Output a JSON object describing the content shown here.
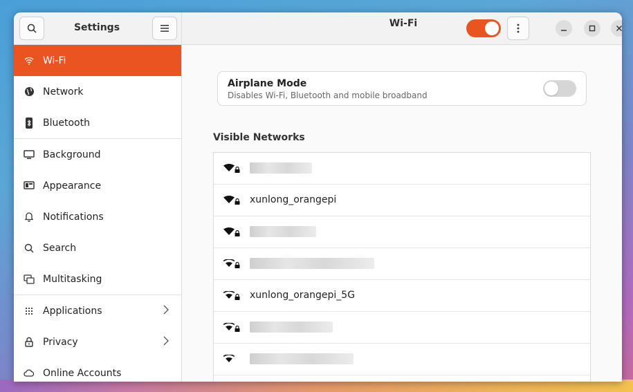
{
  "sidebar": {
    "title": "Settings",
    "items": [
      {
        "label": "Wi-Fi",
        "icon": "wifi-icon"
      },
      {
        "label": "Network",
        "icon": "globe-icon"
      },
      {
        "label": "Bluetooth",
        "icon": "bluetooth-icon"
      },
      {
        "label": "Background",
        "icon": "monitor-icon"
      },
      {
        "label": "Appearance",
        "icon": "appearance-icon"
      },
      {
        "label": "Notifications",
        "icon": "bell-icon"
      },
      {
        "label": "Search",
        "icon": "search-icon"
      },
      {
        "label": "Multitasking",
        "icon": "multitasking-icon"
      },
      {
        "label": "Applications",
        "icon": "grid-icon"
      },
      {
        "label": "Privacy",
        "icon": "lock-icon"
      },
      {
        "label": "Online Accounts",
        "icon": "cloud-icon"
      }
    ]
  },
  "header": {
    "title": "Wi-Fi",
    "wifi_enabled": true
  },
  "airplane": {
    "title": "Airplane Mode",
    "subtitle": "Disables Wi-Fi, Bluetooth and mobile broadband",
    "enabled": false
  },
  "networks": {
    "section_title": "Visible Networks",
    "items": [
      {
        "ssid": "",
        "redacted": true,
        "secured": true
      },
      {
        "ssid": "xunlong_orangepi",
        "redacted": false,
        "secured": true
      },
      {
        "ssid": "",
        "redacted": true,
        "secured": true
      },
      {
        "ssid": "",
        "redacted": true,
        "secured": true
      },
      {
        "ssid": "xunlong_orangepi_5G",
        "redacted": false,
        "secured": true
      },
      {
        "ssid": "",
        "redacted": true,
        "secured": true
      },
      {
        "ssid": "",
        "redacted": true,
        "secured": false
      }
    ]
  },
  "colors": {
    "accent": "#e95420",
    "sidebar_bg": "#ffffff",
    "content_bg": "#fafafa"
  }
}
